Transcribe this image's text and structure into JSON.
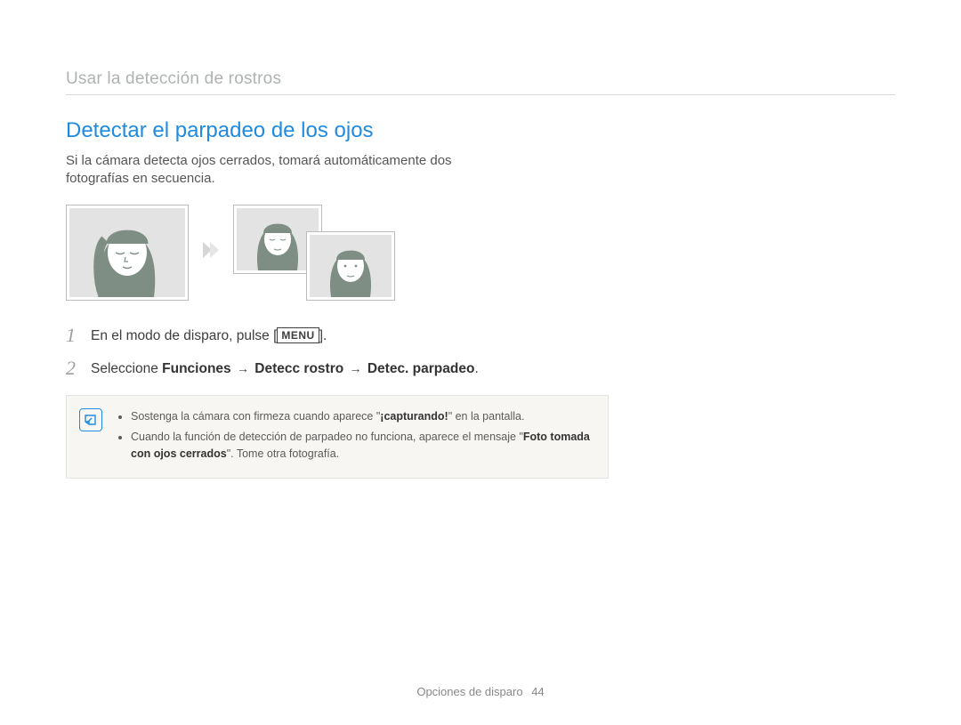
{
  "breadcrumb": "Usar la detección de rostros",
  "title": "Detectar el parpadeo de los ojos",
  "description": "Si la cámara detecta ojos cerrados, tomará automáticamente dos fotografías en secuencia.",
  "steps": {
    "s1": {
      "num": "1",
      "pre": "En el modo de disparo, pulse [",
      "menu_label": "MENU",
      "post": "]."
    },
    "s2": {
      "num": "2",
      "pre": "Seleccione ",
      "b1": "Funciones",
      "b2": "Detecc rostro",
      "b3": "Detec. parpadeo",
      "period": "."
    }
  },
  "note": {
    "item1_pre": "Sostenga la cámara con firmeza cuando aparece ",
    "item1_q1": "\"",
    "item1_b": "¡capturando!",
    "item1_q2": "\"",
    "item1_post": " en la pantalla.",
    "item2_pre": "Cuando la función de detección de parpadeo no funciona, aparece el mensaje ",
    "item2_q1": "\"",
    "item2_b": "Foto tomada con ojos cerrados",
    "item2_q2": "\"",
    "item2_post": ". Tome otra fotografía."
  },
  "footer": {
    "section": "Opciones de disparo",
    "page": "44"
  },
  "arrow_glyph": "→"
}
